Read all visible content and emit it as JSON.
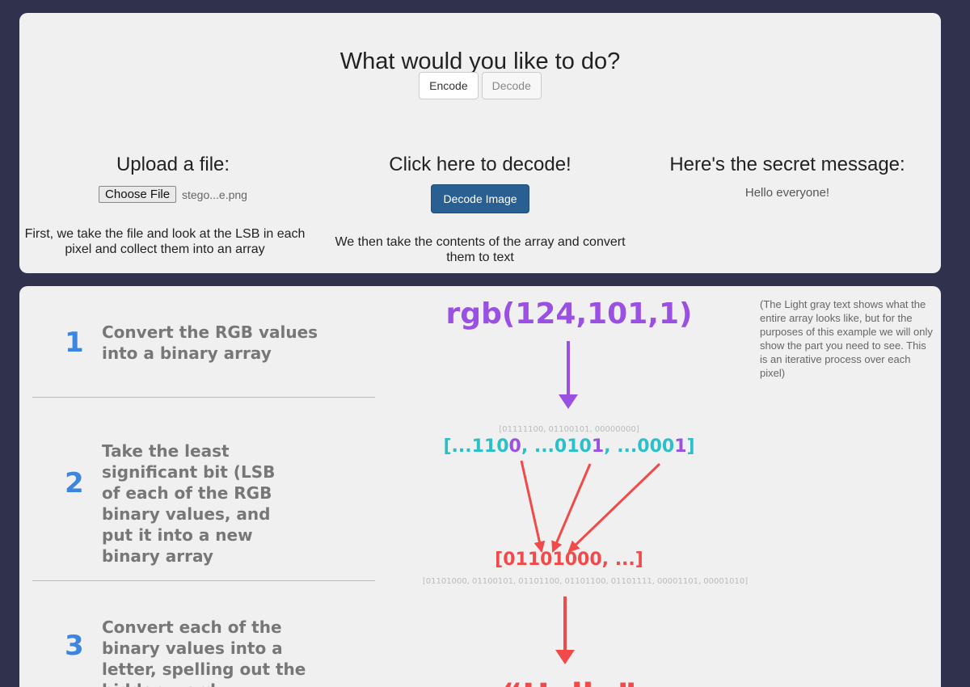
{
  "top": {
    "heading": "What would you like to do?",
    "modes": {
      "encode": "Encode",
      "decode": "Decode"
    },
    "upload": {
      "title": "Upload a file:",
      "button": "Choose File",
      "filename": "stego...e.png",
      "description": "First, we take the file and look at the LSB in each pixel and collect them into an array"
    },
    "decode": {
      "title": "Click here to decode!",
      "button": "Decode Image",
      "description": "We then take the contents of the array and convert them to text"
    },
    "secret": {
      "title": "Here's the secret message:",
      "message": "Hello everyone!"
    }
  },
  "diagram": {
    "steps": [
      {
        "number": "1",
        "text": "Convert the RGB values into a binary array"
      },
      {
        "number": "2",
        "text": "Take the least significant bit (LSB of each of the RGB binary values, and put it into a new binary array"
      },
      {
        "number": "3",
        "text": "Convert each of the binary values into a letter, spelling out the hidden word"
      }
    ],
    "note": "(The Light gray text shows what the entire array looks like, but for the purposes of this example we will only show the part you need to see. This is an iterative process over each pixel)",
    "rgb": "rgb(124,101,1)",
    "full_binary": "[01111100, 01100101, 00000000]",
    "bits": {
      "open": "[",
      "v1_prefix": "...110",
      "v1_lsb": "0",
      "sep1": ", ",
      "v2_prefix": "...010",
      "v2_lsb": "1",
      "sep2": ", ",
      "v3_prefix": "...000",
      "v3_lsb": "1",
      "close": "]"
    },
    "lsb_array": "[01101000, ...]",
    "full_lsb_array": "[01101000, 01100101, 01101100, 01101100, 01101111, 00001101, 00001010]",
    "result": "“Hello”",
    "colors": {
      "purple": "#9950e3",
      "cyan": "#2bbfc8",
      "red": "#f04a4a",
      "step_blue": "#3d86e0"
    }
  }
}
